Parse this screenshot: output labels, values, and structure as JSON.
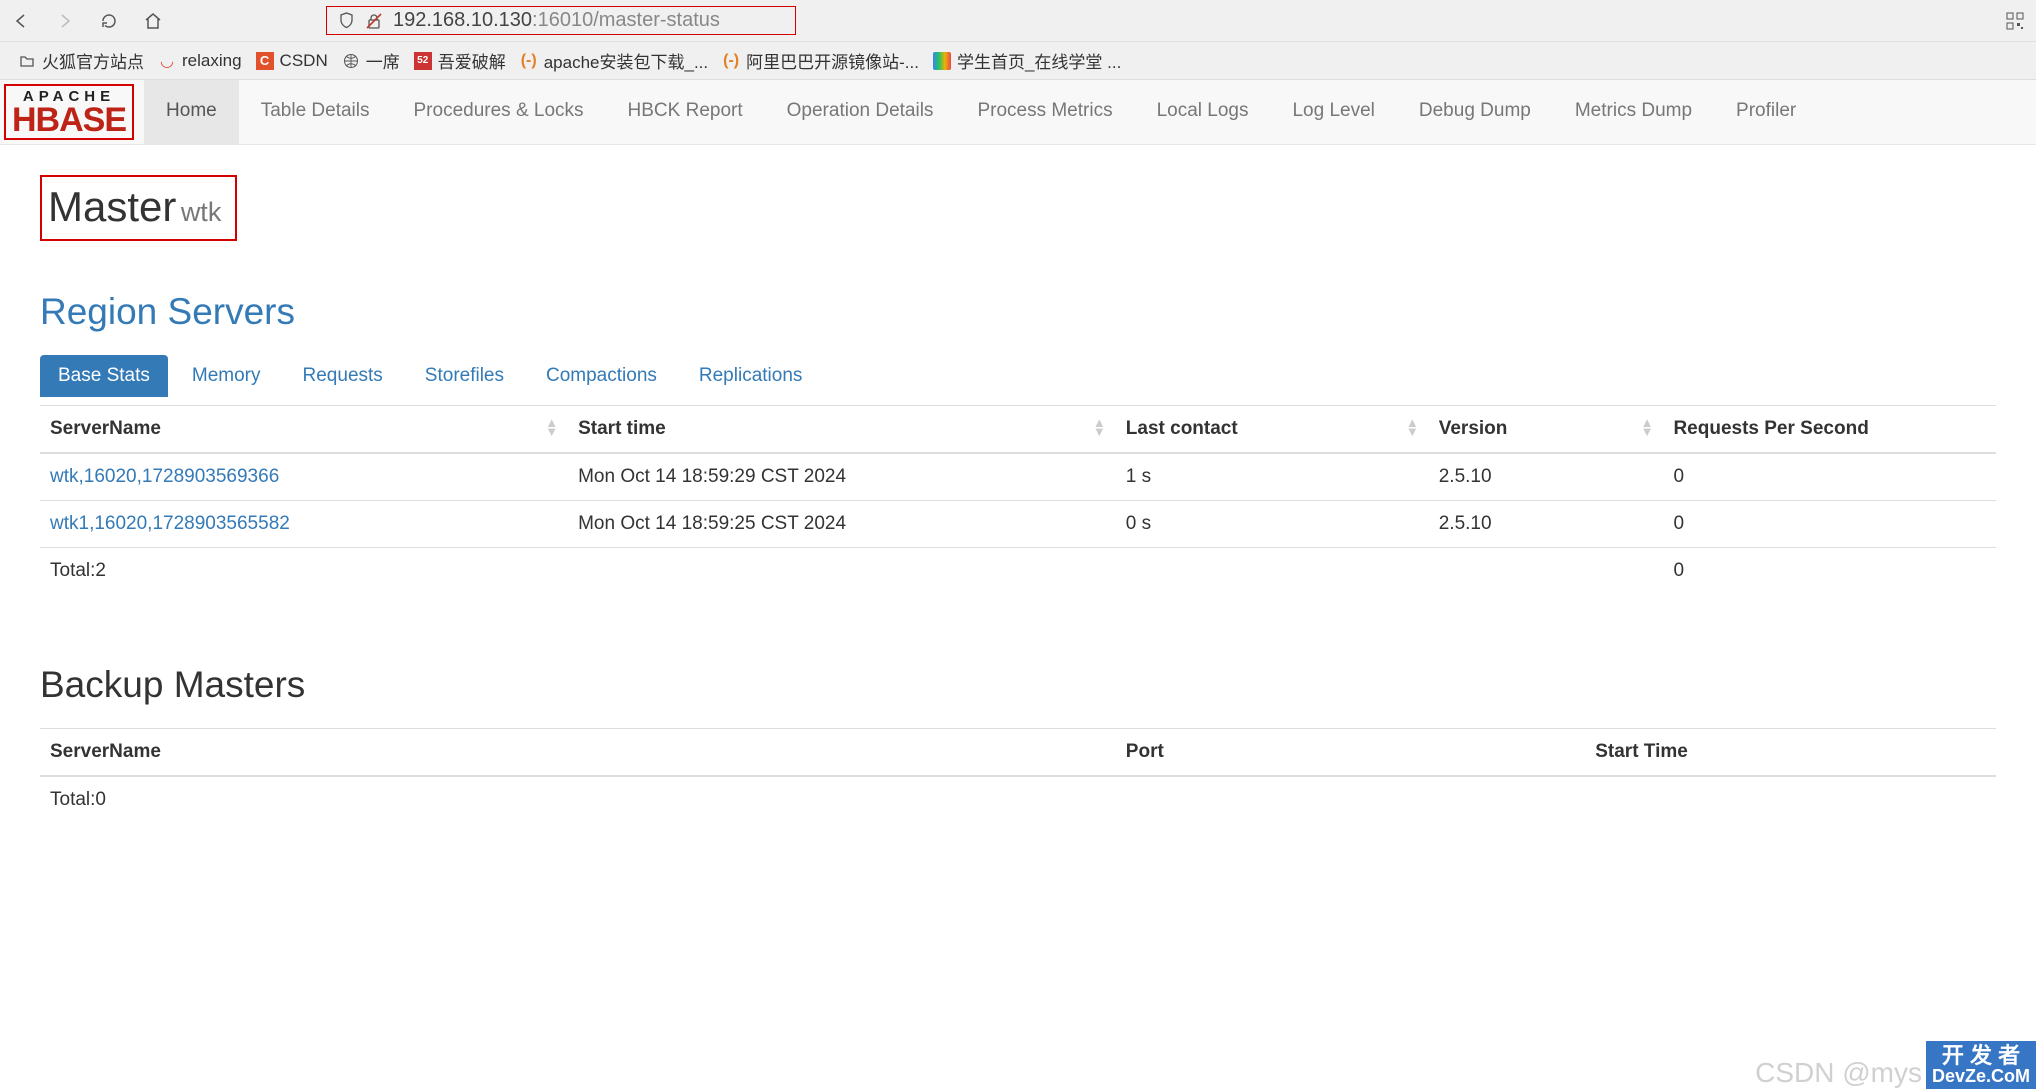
{
  "url": {
    "host": "192.168.10.130",
    "port": ":16010",
    "path": "/master-status"
  },
  "bookmarks": [
    {
      "icon": "folder",
      "label": "火狐官方站点"
    },
    {
      "icon": "pocket",
      "label": "relaxing"
    },
    {
      "icon": "csdn",
      "label": "CSDN"
    },
    {
      "icon": "globe",
      "label": "一席"
    },
    {
      "icon": "red52",
      "label": "吾爱破解"
    },
    {
      "icon": "apache",
      "label": "apache安装包下载_..."
    },
    {
      "icon": "apache",
      "label": "阿里巴巴开源镜像站-..."
    },
    {
      "icon": "rainbow",
      "label": "学生首页_在线学堂 ..."
    }
  ],
  "logo": {
    "top": "APACHE",
    "main": "HBASE"
  },
  "nav": [
    "Home",
    "Table Details",
    "Procedures & Locks",
    "HBCK Report",
    "Operation Details",
    "Process Metrics",
    "Local Logs",
    "Log Level",
    "Debug Dump",
    "Metrics Dump",
    "Profiler"
  ],
  "master": {
    "title": "Master",
    "sub": "wtk"
  },
  "region_servers": {
    "heading": "Region Servers",
    "tabs": [
      "Base Stats",
      "Memory",
      "Requests",
      "Storefiles",
      "Compactions",
      "Replications"
    ],
    "columns": [
      "ServerName",
      "Start time",
      "Last contact",
      "Version",
      "Requests Per Second"
    ],
    "rows": [
      {
        "server": "wtk,16020,1728903569366",
        "start": "Mon Oct 14 18:59:29 CST 2024",
        "contact": "1 s",
        "version": "2.5.10",
        "rps": "0"
      },
      {
        "server": "wtk1,16020,1728903565582",
        "start": "Mon Oct 14 18:59:25 CST 2024",
        "contact": "0 s",
        "version": "2.5.10",
        "rps": "0"
      }
    ],
    "total_label": "Total:2",
    "total_rps": "0"
  },
  "backup_masters": {
    "heading": "Backup Masters",
    "columns": [
      "ServerName",
      "Port",
      "Start Time"
    ],
    "total_label": "Total:0"
  },
  "watermark": {
    "csdn": "CSDN @mys",
    "badge_cn": "开 发 者",
    "badge_en": "DevZe.CoM"
  }
}
